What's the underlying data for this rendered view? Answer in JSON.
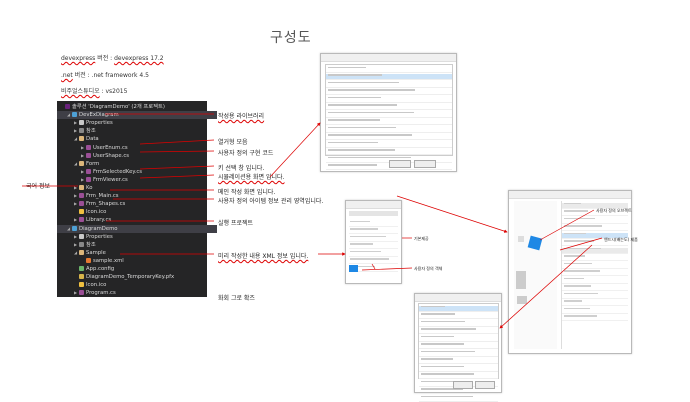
{
  "title": "구성도",
  "info": {
    "line1_a": "devexpress",
    "line1_b": " 버전 : ",
    "line1_c": "devexpress 17.2",
    "line2_a": ".net",
    "line2_b": " 버전 : .net framework 4.5",
    "line3_a": "비주얼스튜디오",
    "line3_b": " : vs2015"
  },
  "explorer": {
    "rows": [
      {
        "indent": 0,
        "tw": "",
        "icon": "sol",
        "label": "솔루션 'DiagramDemo' (2개 프로젝트)"
      },
      {
        "indent": 1,
        "tw": "◢",
        "icon": "prj",
        "label": "DevExDiagram",
        "sel": true
      },
      {
        "indent": 2,
        "tw": "▶",
        "icon": "wr",
        "label": "Properties"
      },
      {
        "indent": 2,
        "tw": "▶",
        "icon": "ref",
        "label": "참조"
      },
      {
        "indent": 2,
        "tw": "◢",
        "icon": "fold",
        "label": "Data"
      },
      {
        "indent": 3,
        "tw": "▶",
        "icon": "cs",
        "label": "UserEnum.cs"
      },
      {
        "indent": 3,
        "tw": "▶",
        "icon": "cs",
        "label": "UserShape.cs"
      },
      {
        "indent": 2,
        "tw": "◢",
        "icon": "fold",
        "label": "Form"
      },
      {
        "indent": 3,
        "tw": "▶",
        "icon": "cs",
        "label": "FrmSelectedKey.cs"
      },
      {
        "indent": 3,
        "tw": "▶",
        "icon": "cs",
        "label": "FrmViewer.cs"
      },
      {
        "indent": 2,
        "tw": "▶",
        "icon": "fold",
        "label": "Ko"
      },
      {
        "indent": 2,
        "tw": "▶",
        "icon": "cs",
        "label": "Frm_Main.cs"
      },
      {
        "indent": 2,
        "tw": "▶",
        "icon": "cs",
        "label": "Frm_Shapes.cs"
      },
      {
        "indent": 2,
        "tw": "",
        "icon": "ico",
        "label": "Icon.ico"
      },
      {
        "indent": 2,
        "tw": "▶",
        "icon": "cs",
        "label": "Library.cs"
      },
      {
        "indent": 1,
        "tw": "◢",
        "icon": "prj",
        "label": "DiagramDemo",
        "sel": true
      },
      {
        "indent": 2,
        "tw": "▶",
        "icon": "wr",
        "label": "Properties"
      },
      {
        "indent": 2,
        "tw": "▶",
        "icon": "ref",
        "label": "참조"
      },
      {
        "indent": 2,
        "tw": "◢",
        "icon": "fold",
        "label": "Sample"
      },
      {
        "indent": 3,
        "tw": "",
        "icon": "xml",
        "label": "sample.xml"
      },
      {
        "indent": 2,
        "tw": "",
        "icon": "cfg",
        "label": "App.config"
      },
      {
        "indent": 2,
        "tw": "",
        "icon": "pfx",
        "label": "DiagramDemo_TemporaryKey.pfx"
      },
      {
        "indent": 2,
        "tw": "",
        "icon": "ico",
        "label": "Icon.ico"
      },
      {
        "indent": 2,
        "tw": "▶",
        "icon": "cs",
        "label": "Program.cs"
      }
    ]
  },
  "callouts": {
    "c1": "작성용 라이브러리",
    "c2": "열거형 모음",
    "c3": "사용자 정의 구현 코드",
    "c4": "키 선택 창 입니다.",
    "c5": "시뮬레이션용 화면 입니다.",
    "c6": "메인 작성 화면 입니다.",
    "c7": "사용자 정의 아이템 정보 관리 영역입니다.",
    "c8": "실행 프로젝트",
    "c9": "미리 작성한 내용 XML 정보 입니다.",
    "lang": "국어 정보",
    "bottom": "화회 그로 확즈",
    "menu_a": "기본제공",
    "menu_b": "사용자 정의 객체",
    "rp_a": "사용자 정의 오브젝트",
    "rp_b": "엔드시(배는도) 제품"
  }
}
